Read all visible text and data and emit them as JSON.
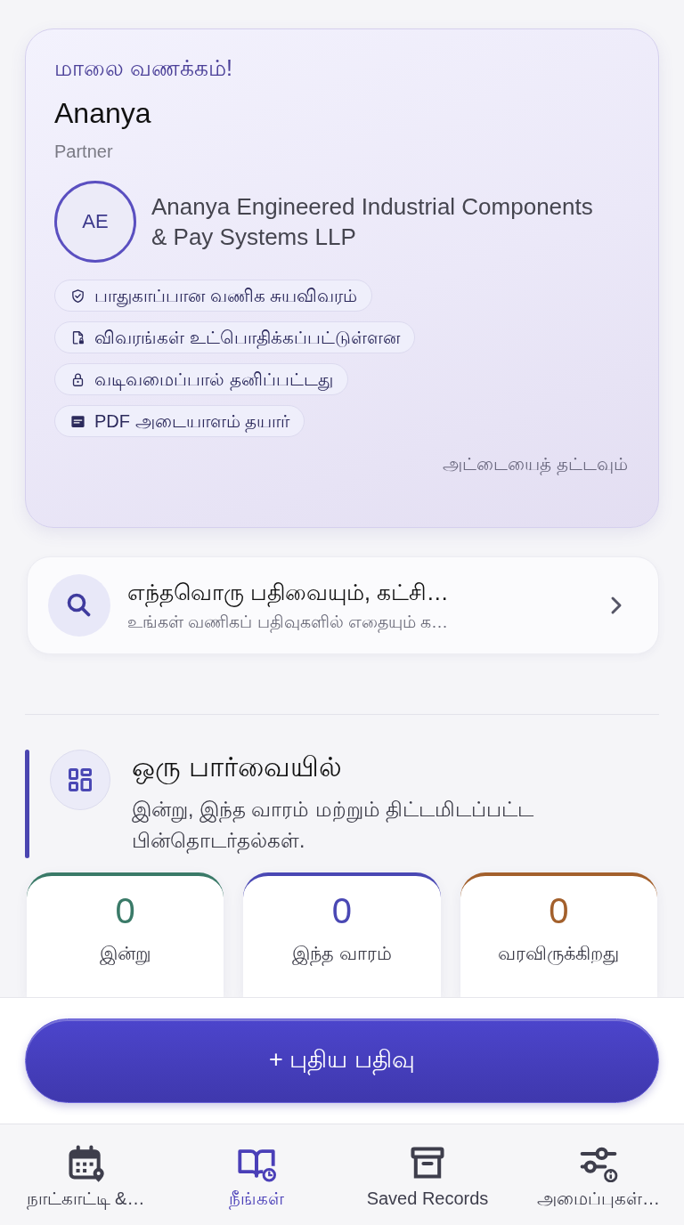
{
  "profile_card": {
    "greeting": "மாலை வணக்கம்!",
    "name": "Ananya",
    "role": "Partner",
    "initials": "AE",
    "company": "Ananya Engineered Industrial Components & Pay Systems LLP",
    "chips": [
      {
        "kind": "shield",
        "label": "பாதுகாப்பான வணிக சுயவிவரம்"
      },
      {
        "kind": "file",
        "label": "விவரங்கள் உட்பொதிக்கப்பட்டுள்ளன"
      },
      {
        "kind": "lock",
        "label": "வடிவமைப்பால் தனிப்பட்டது"
      },
      {
        "kind": "pdf",
        "label": "PDF அடையாளம் தயார்"
      }
    ],
    "hint": "அட்டையைத் தட்டவும்"
  },
  "search_card": {
    "title": "எந்தவொரு பதிவையும், கட்சி…",
    "subtitle": "உங்கள் வணிகப் பதிவுகளில் எதையும் க…"
  },
  "overview": {
    "title": "ஒரு பார்வையில்",
    "subtitle": "இன்று, இந்த வாரம் மற்றும் திட்டமிடப்பட்ட பின்தொடர்தல்கள்.",
    "stats": [
      {
        "value": "0",
        "label": "இன்று",
        "color": "#3a7a68"
      },
      {
        "value": "0",
        "label": "இந்த வாரம்",
        "color": "#4a48b4"
      },
      {
        "value": "0",
        "label": "வரவிருக்கிறது",
        "color": "#a3602c"
      }
    ]
  },
  "new_button": {
    "label": "+ புதிய பதிவு"
  },
  "nav": [
    {
      "kind": "calendar",
      "label": "நாட்காட்டி &…",
      "selected": false
    },
    {
      "kind": "book",
      "label": "நீங்கள்",
      "selected": true
    },
    {
      "kind": "archive",
      "label": "Saved Records",
      "selected": false
    },
    {
      "kind": "settings",
      "label": "அமைப்புகள்…",
      "selected": false
    }
  ]
}
